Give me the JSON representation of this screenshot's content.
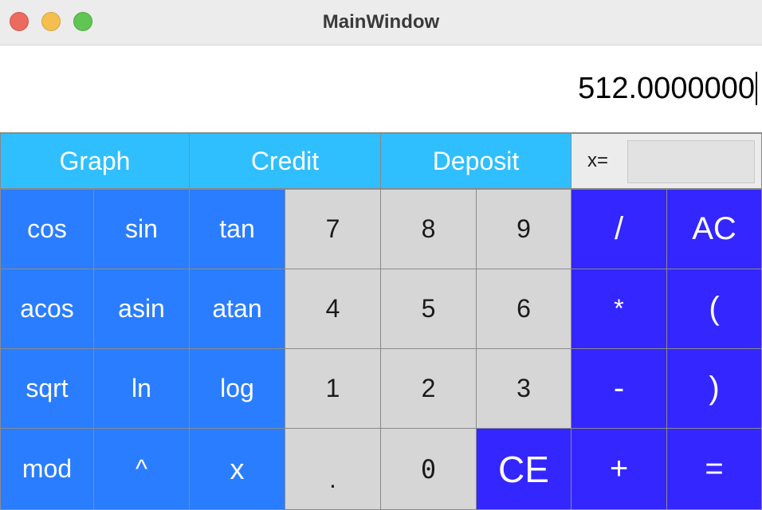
{
  "window": {
    "title": "MainWindow"
  },
  "display": {
    "value": "512.0000000"
  },
  "modes": [
    {
      "label": "Graph"
    },
    {
      "label": "Credit"
    },
    {
      "label": "Deposit"
    }
  ],
  "x_field": {
    "label": "x=",
    "value": ""
  },
  "functions": [
    {
      "label": "cos"
    },
    {
      "label": "sin"
    },
    {
      "label": "tan"
    },
    {
      "label": "acos"
    },
    {
      "label": "asin"
    },
    {
      "label": "atan"
    },
    {
      "label": "sqrt"
    },
    {
      "label": "ln"
    },
    {
      "label": "log"
    },
    {
      "label": "mod"
    },
    {
      "label": "^"
    },
    {
      "label": "x"
    }
  ],
  "digits": [
    {
      "label": "7"
    },
    {
      "label": "8"
    },
    {
      "label": "9"
    },
    {
      "label": "4"
    },
    {
      "label": "5"
    },
    {
      "label": "6"
    },
    {
      "label": "1"
    },
    {
      "label": "2"
    },
    {
      "label": "3"
    },
    {
      "label": "."
    },
    {
      "label": "0"
    }
  ],
  "operators": {
    "divide": "/",
    "clear_all": "AC",
    "multiply": "*",
    "open_paren": "(",
    "minus": "-",
    "close_paren": ")",
    "clear_entry": "CE",
    "plus": "+",
    "equals": "="
  },
  "colors": {
    "mode_button": "#2fbfff",
    "function_button": "#2a7dff",
    "digit_button": "#d6d6d6",
    "operator_button": "#3426ff"
  }
}
